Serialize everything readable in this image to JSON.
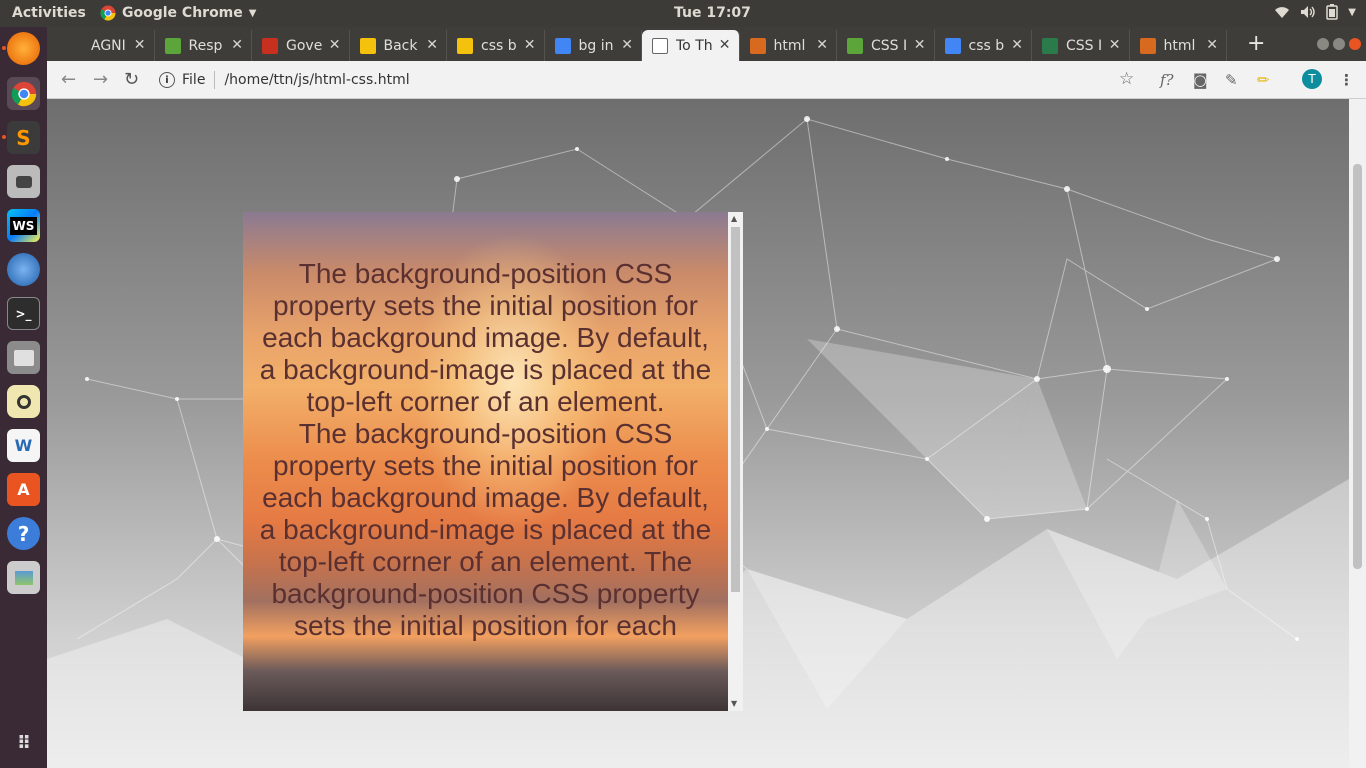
{
  "topbar": {
    "activities": "Activities",
    "app_name": "Google Chrome",
    "clock": "Tue 17:07"
  },
  "dock": {
    "items": [
      "Firefox",
      "Chrome",
      "Sublime Text",
      "Screenshot",
      "WebStorm",
      "Thunderbird",
      "Terminal",
      "Files",
      "Rhythmbox",
      "LibreOffice Writer",
      "Ubuntu Software",
      "Help",
      "Image Viewer"
    ],
    "show_apps": "Show Applications"
  },
  "tabs": [
    {
      "label": "AGNI",
      "favicon_color": "#3e3d39"
    },
    {
      "label": "Resp",
      "favicon_color": "#5ba53a"
    },
    {
      "label": "Gove",
      "favicon_color": "#c7301f"
    },
    {
      "label": "Back",
      "favicon_color": "#f4c20d"
    },
    {
      "label": "css b",
      "favicon_color": "#f4c20d"
    },
    {
      "label": "bg in",
      "favicon_color": "#4285f4"
    },
    {
      "label": "To Th",
      "favicon_color": "#ffffff"
    },
    {
      "label": "html",
      "favicon_color": "#d86a1f"
    },
    {
      "label": "CSS I",
      "favicon_color": "#5ba53a"
    },
    {
      "label": "css b",
      "favicon_color": "#4285f4"
    },
    {
      "label": "CSS I",
      "favicon_color": "#2b7b4a"
    },
    {
      "label": "html",
      "favicon_color": "#d86a1f"
    }
  ],
  "active_tab_index": 6,
  "toolbar": {
    "security_label": "File",
    "url": "/home/ttn/js/html-css.html",
    "profile_initial": "T"
  },
  "content": {
    "paragraph_1": "The background-position CSS property sets the initial position for each background image. By default, a background-image is placed at the top-left corner of an element.",
    "paragraph_2": "The background-position CSS property sets the initial position for each background image. By default, a background-image is placed at the top-left corner of an element. The background-position CSS property sets the initial position for each"
  },
  "colors": {
    "accent": "#e95420",
    "dock": "#3a2a35",
    "topbar": "#3c3b37"
  }
}
